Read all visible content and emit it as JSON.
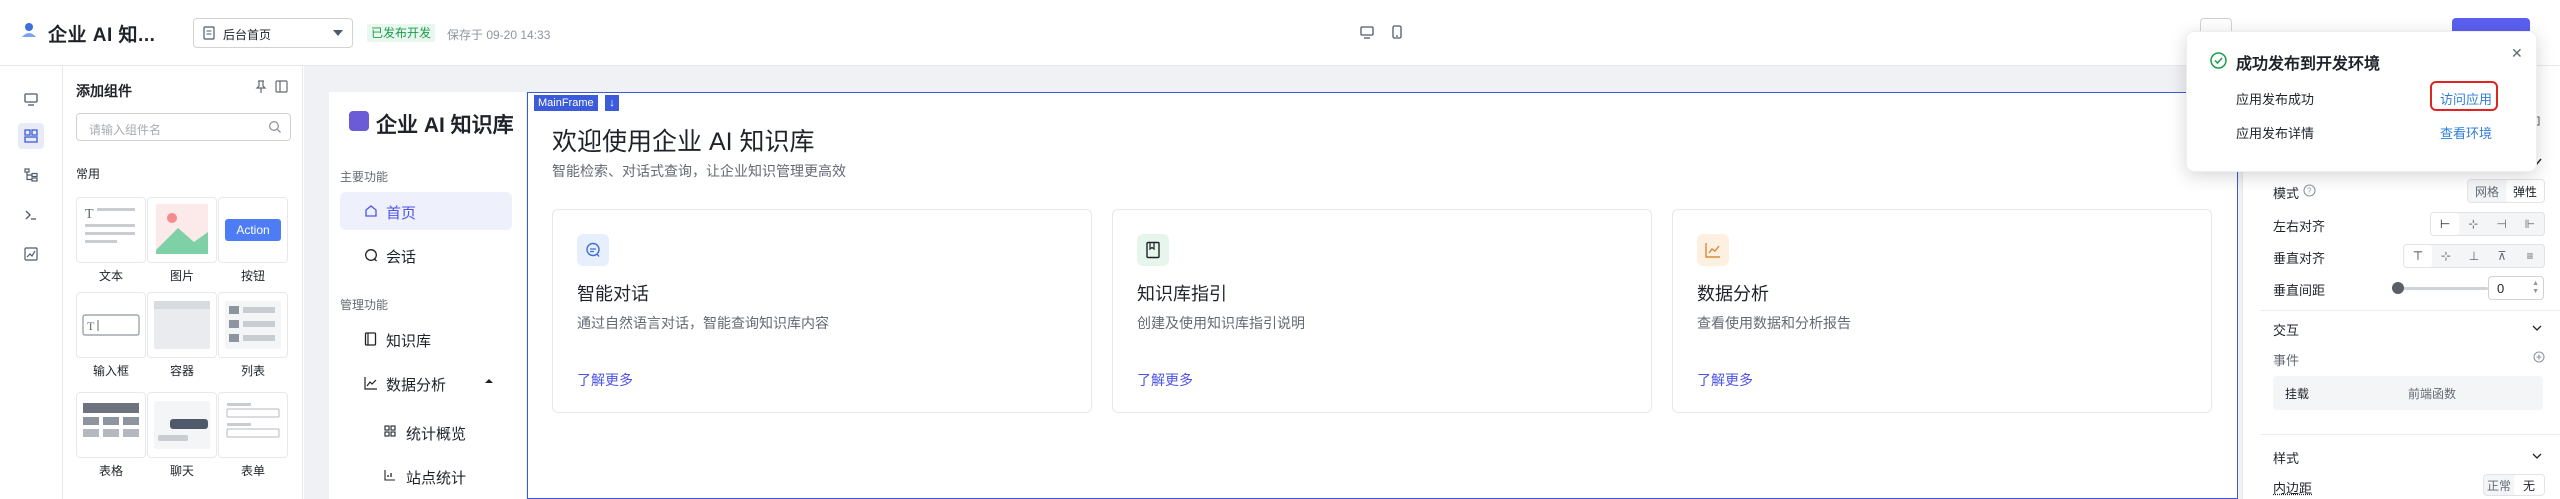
{
  "header": {
    "app_title": "企业 AI 知...",
    "page_select": "后台首页",
    "status_badge": "已发布开发",
    "saved_text": "保存于 09-20 14:33",
    "colors": {
      "accent": "#5b5ff0",
      "published_bg": "#e8f8ee",
      "published_text": "#1a9c4c"
    }
  },
  "rail": {
    "items": [
      "monitor-icon",
      "components-icon",
      "tree-icon",
      "terminal-icon",
      "chart-icon"
    ]
  },
  "component_panel": {
    "title": "添加组件",
    "search_placeholder": "请输入组件名",
    "section": "常用",
    "tiles": [
      {
        "label": "文本",
        "icon": "text-component-icon"
      },
      {
        "label": "图片",
        "icon": "image-component-icon"
      },
      {
        "label": "按钮",
        "icon": "button-component-icon",
        "preview_text": "Action"
      },
      {
        "label": "输入框",
        "icon": "input-component-icon"
      },
      {
        "label": "容器",
        "icon": "container-component-icon"
      },
      {
        "label": "列表",
        "icon": "list-component-icon"
      },
      {
        "label": "表格",
        "icon": "table-component-icon"
      },
      {
        "label": "聊天",
        "icon": "chat-component-icon"
      },
      {
        "label": "表单",
        "icon": "form-component-icon"
      }
    ]
  },
  "app_preview": {
    "brand": "企业 AI 知识库",
    "frame_tag": "MainFrame",
    "nav_groups": [
      {
        "title": "主要功能",
        "items": [
          {
            "label": "首页",
            "active": true
          },
          {
            "label": "会话"
          }
        ]
      },
      {
        "title": "管理功能",
        "items": [
          {
            "label": "知识库"
          },
          {
            "label": "数据分析",
            "expanded": true
          },
          {
            "label": "统计概览"
          },
          {
            "label": "站点统计"
          }
        ]
      }
    ],
    "welcome_title": "欢迎使用企业 AI 知识库",
    "welcome_sub": "智能检索、对话式查询，让企业知识管理更高效",
    "cards": [
      {
        "title": "智能对话",
        "desc": "通过自然语言对话，智能查询知识库内容",
        "link": "了解更多",
        "icon_color": "#3b6fd8",
        "icon_bg": "#e8effc"
      },
      {
        "title": "知识库指引",
        "desc": "创建及使用知识库指引说明",
        "link": "了解更多",
        "icon_color": "#1f2329",
        "icon_bg": "#e6f6ec"
      },
      {
        "title": "数据分析",
        "desc": "查看使用数据和分析报告",
        "link": "了解更多",
        "icon_color": "#d98a3a",
        "icon_bg": "#fdf0e1"
      }
    ]
  },
  "properties": {
    "mode_label": "模式",
    "mode_options": [
      "网格",
      "弹性"
    ],
    "h_align_label": "左右对齐",
    "v_align_label": "垂直对齐",
    "v_gap_label": "垂直间距",
    "v_gap_value": "0",
    "interaction_title": "交互",
    "event_label": "事件",
    "event_row": {
      "key": "挂载",
      "value": "前端函数"
    },
    "style_title": "样式",
    "padding_label": "内边距",
    "padding_options": [
      "正常",
      "无"
    ]
  },
  "toast": {
    "title": "成功发布到开发环境",
    "rows": [
      {
        "label": "应用发布成功",
        "link": "访问应用"
      },
      {
        "label": "应用发布详情",
        "link": "查看环境"
      }
    ]
  }
}
